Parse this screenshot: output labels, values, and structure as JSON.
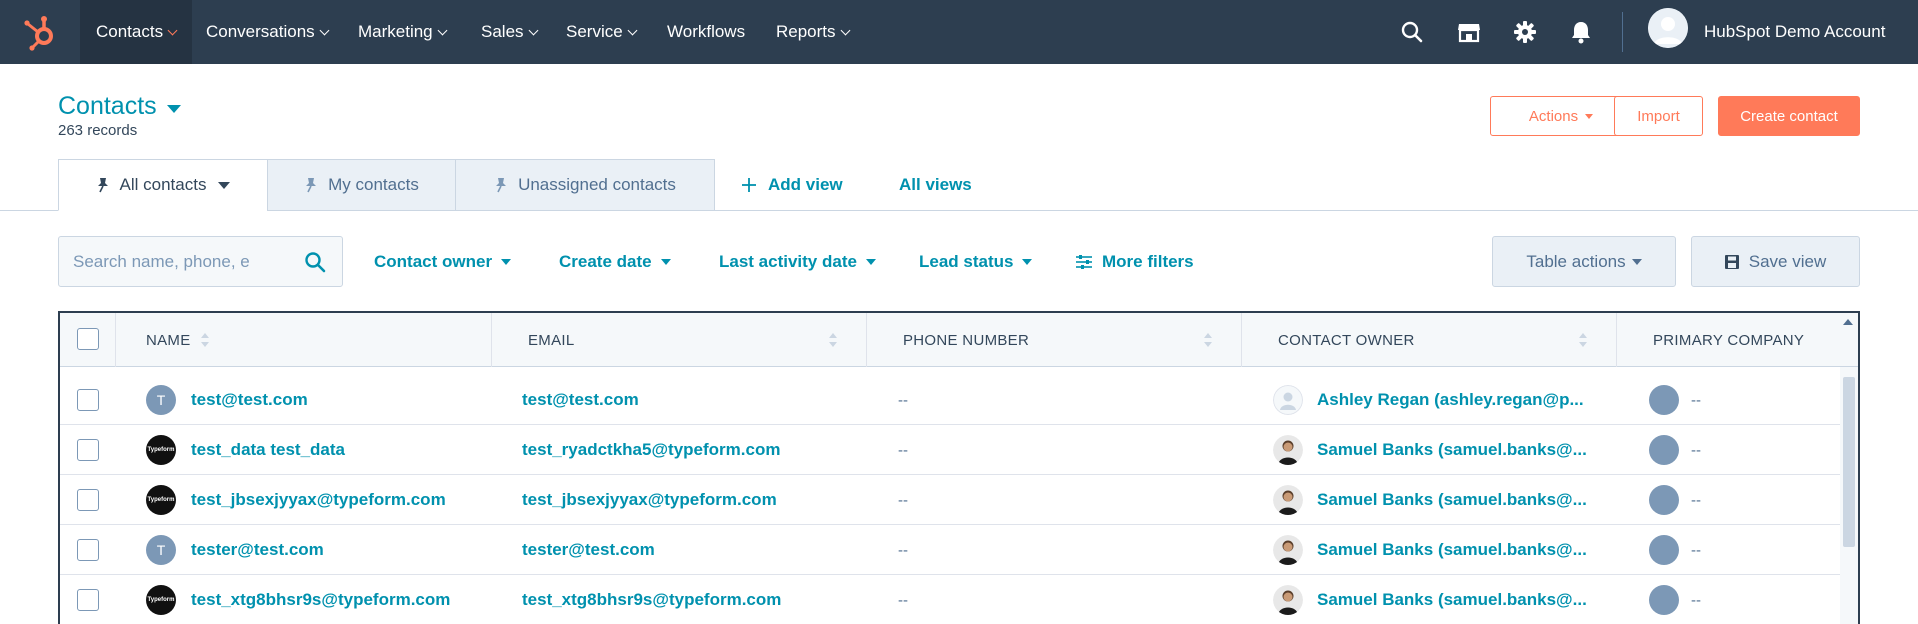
{
  "nav": {
    "items": [
      {
        "label": "Contacts",
        "active": true
      },
      {
        "label": "Conversations"
      },
      {
        "label": "Marketing"
      },
      {
        "label": "Sales"
      },
      {
        "label": "Service"
      },
      {
        "label": "Workflows"
      },
      {
        "label": "Reports"
      }
    ],
    "account_name": "HubSpot Demo Account"
  },
  "header": {
    "title": "Contacts",
    "record_count": "263 records",
    "actions_label": "Actions",
    "import_label": "Import",
    "create_label": "Create contact"
  },
  "tabs": {
    "all_contacts": "All contacts",
    "my_contacts": "My contacts",
    "unassigned_contacts": "Unassigned contacts",
    "add_view": "Add view",
    "all_views": "All views"
  },
  "filters": {
    "search_placeholder": "Search name, phone, e",
    "contact_owner": "Contact owner",
    "create_date": "Create date",
    "last_activity_date": "Last activity date",
    "lead_status": "Lead status",
    "more_filters": "More filters",
    "table_actions": "Table actions",
    "save_view": "Save view"
  },
  "table": {
    "columns": [
      "NAME",
      "EMAIL",
      "PHONE NUMBER",
      "CONTACT OWNER",
      "PRIMARY COMPANY"
    ],
    "rows": [
      {
        "avatar": "T",
        "avatar_type": "initial",
        "name": "test@test.com",
        "email": "test@test.com",
        "phone": "--",
        "owner": "Ashley Regan (ashley.regan@p...",
        "owner_avatar": "placeholder",
        "company": "--"
      },
      {
        "avatar": "Typeform",
        "avatar_type": "typeform",
        "name": "test_data test_data",
        "email": "test_ryadctkha5@typeform.com",
        "phone": "--",
        "owner": "Samuel Banks (samuel.banks@...",
        "owner_avatar": "person",
        "company": "--"
      },
      {
        "avatar": "Typeform",
        "avatar_type": "typeform",
        "name": "test_jbsexjyyax@typeform.com",
        "email": "test_jbsexjyyax@typeform.com",
        "phone": "--",
        "owner": "Samuel Banks (samuel.banks@...",
        "owner_avatar": "person",
        "company": "--"
      },
      {
        "avatar": "T",
        "avatar_type": "initial",
        "name": "tester@test.com",
        "email": "tester@test.com",
        "phone": "--",
        "owner": "Samuel Banks (samuel.banks@...",
        "owner_avatar": "person",
        "company": "--"
      },
      {
        "avatar": "Typeform",
        "avatar_type": "typeform",
        "name": "test_xtg8bhsr9s@typeform.com",
        "email": "test_xtg8bhsr9s@typeform.com",
        "phone": "--",
        "owner": "Samuel Banks (samuel.banks@...",
        "owner_avatar": "person",
        "company": "--"
      }
    ]
  },
  "colors": {
    "nav_bg": "#2d3e50",
    "accent": "#ff7a59",
    "link": "#0091ae",
    "text": "#33475b"
  },
  "icons": {
    "logo": "hubspot-sprocket-icon",
    "search": "search-icon",
    "marketplace": "marketplace-icon",
    "settings": "gear-icon",
    "notifications": "bell-icon"
  }
}
